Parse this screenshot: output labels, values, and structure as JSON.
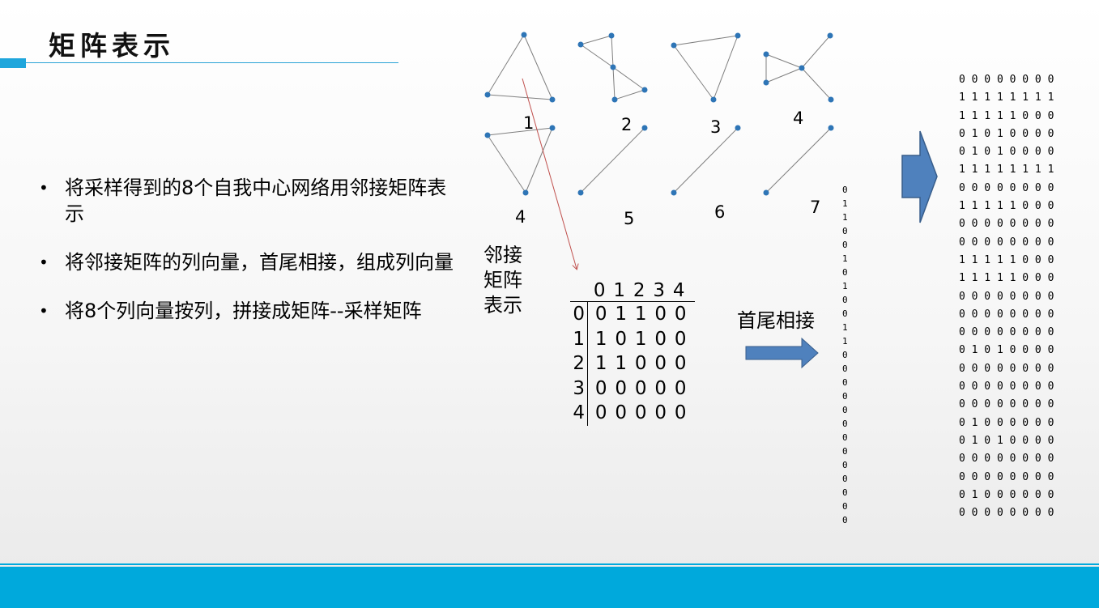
{
  "title": "矩阵表示",
  "bullets": [
    "将采样得到的8个自我中心网络用邻接矩阵表示",
    "将邻接矩阵的列向量，首尾相接，组成列向量",
    "将8个列向量按列，拼接成矩阵--采样矩阵"
  ],
  "graph_labels": [
    "1",
    "2",
    "3",
    "4",
    "4",
    "5",
    "6",
    "7"
  ],
  "side_label": "邻接矩阵表示",
  "adjacency": {
    "col_headers": [
      "0",
      "1",
      "2",
      "3",
      "4"
    ],
    "rows": [
      {
        "idx": "0",
        "cells": [
          "0",
          "1",
          "1",
          "0",
          "0"
        ]
      },
      {
        "idx": "1",
        "cells": [
          "1",
          "0",
          "1",
          "0",
          "0"
        ]
      },
      {
        "idx": "2",
        "cells": [
          "1",
          "1",
          "0",
          "0",
          "0"
        ]
      },
      {
        "idx": "3",
        "cells": [
          "0",
          "0",
          "0",
          "0",
          "0"
        ]
      },
      {
        "idx": "4",
        "cells": [
          "0",
          "0",
          "0",
          "0",
          "0"
        ]
      }
    ]
  },
  "link_label": "首尾相接",
  "column_vector": [
    "0",
    "1",
    "1",
    "0",
    "0",
    "1",
    "0",
    "1",
    "0",
    "0",
    "1",
    "1",
    "0",
    "0",
    "0",
    "0",
    "0",
    "0",
    "0",
    "0",
    "0",
    "0",
    "0",
    "0",
    "0"
  ],
  "sample_matrix": [
    "0 0 0 0 0 0 0 0",
    "1 1 1 1 1 1 1 1",
    "1 1 1 1 1 0 0 0",
    "0 1 0 1 0 0 0 0",
    "0 1 0 1 0 0 0 0",
    "1 1 1 1 1 1 1 1",
    "0 0 0 0 0 0 0 0",
    "1 1 1 1 1 0 0 0",
    "0 0 0 0 0 0 0 0",
    "0 0 0 0 0 0 0 0",
    "1 1 1 1 1 0 0 0",
    "1 1 1 1 1 0 0 0",
    "0 0 0 0 0 0 0 0",
    "0 0 0 0 0 0 0 0",
    "0 0 0 0 0 0 0 0",
    "0 1 0 1 0 0 0 0",
    "0 0 0 0 0 0 0 0",
    "0 0 0 0 0 0 0 0",
    "0 0 0 0 0 0 0 0",
    "0 1 0 0 0 0 0 0",
    "0 1 0 1 0 0 0 0",
    "0 0 0 0 0 0 0 0",
    "0 0 0 0 0 0 0 0",
    "0 1 0 0 0 0 0 0",
    "0 0 0 0 0 0 0 0"
  ],
  "colors": {
    "node": "#2e75b6",
    "edge": "#7f7f7f",
    "arrow": "#4f81bd",
    "pointer": "#c0504d",
    "accent": "#00a9dc"
  }
}
